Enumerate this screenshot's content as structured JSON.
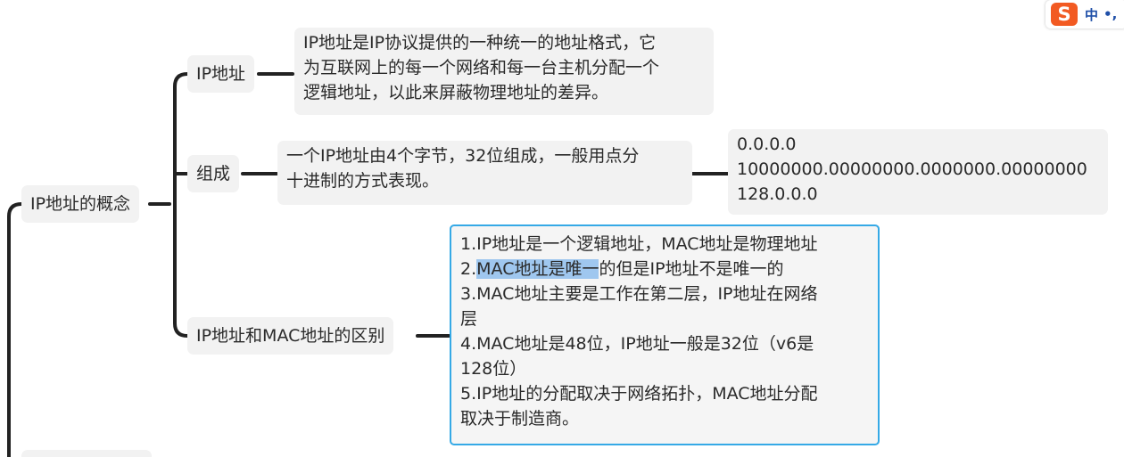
{
  "mindmap": {
    "root": {
      "label": "IP地址的概念"
    },
    "branches": [
      {
        "label": "IP地址",
        "detail_lines": [
          "IP地址是IP协议提供的一种统一的地址格式，它",
          "为互联网上的每一个网络和每一台主机分配一个",
          "逻辑地址，以此来屏蔽物理地址的差异。"
        ]
      },
      {
        "label": "组成",
        "detail_lines": [
          "一个IP地址由4个字节，32位组成，一般用点分",
          "十进制的方式表现。"
        ],
        "sub_detail_lines": [
          "0.0.0.0",
          "10000000.00000000.0000000.00000000",
          "128.0.0.0"
        ]
      },
      {
        "label": "IP地址和MAC地址的区别",
        "detail": {
          "line1": "1.IP地址是一个逻辑地址，MAC地址是物理地址",
          "line2_prefix": "2.",
          "line2_highlight": "MAC地址是唯一",
          "line2_suffix": "的但是IP地址不是唯一的",
          "line3": "3.MAC地址主要是工作在第二层，IP地址在网络",
          "line4": "层",
          "line5": "4.MAC地址是48位，IP地址一般是32位（v6是",
          "line6": "128位）",
          "line7": "5.IP地址的分配取决于网络拓扑，MAC地址分配",
          "line8": "取决于制造商。"
        }
      }
    ]
  },
  "ime": {
    "logo": "S",
    "language": "中",
    "punctuation": "•,"
  },
  "colors": {
    "connector": "#222222",
    "node_bg": "#f2f2f2",
    "selection_border": "#35a9e6",
    "text_highlight": "#9fc7ef",
    "ime_brand": "#f25a22"
  }
}
